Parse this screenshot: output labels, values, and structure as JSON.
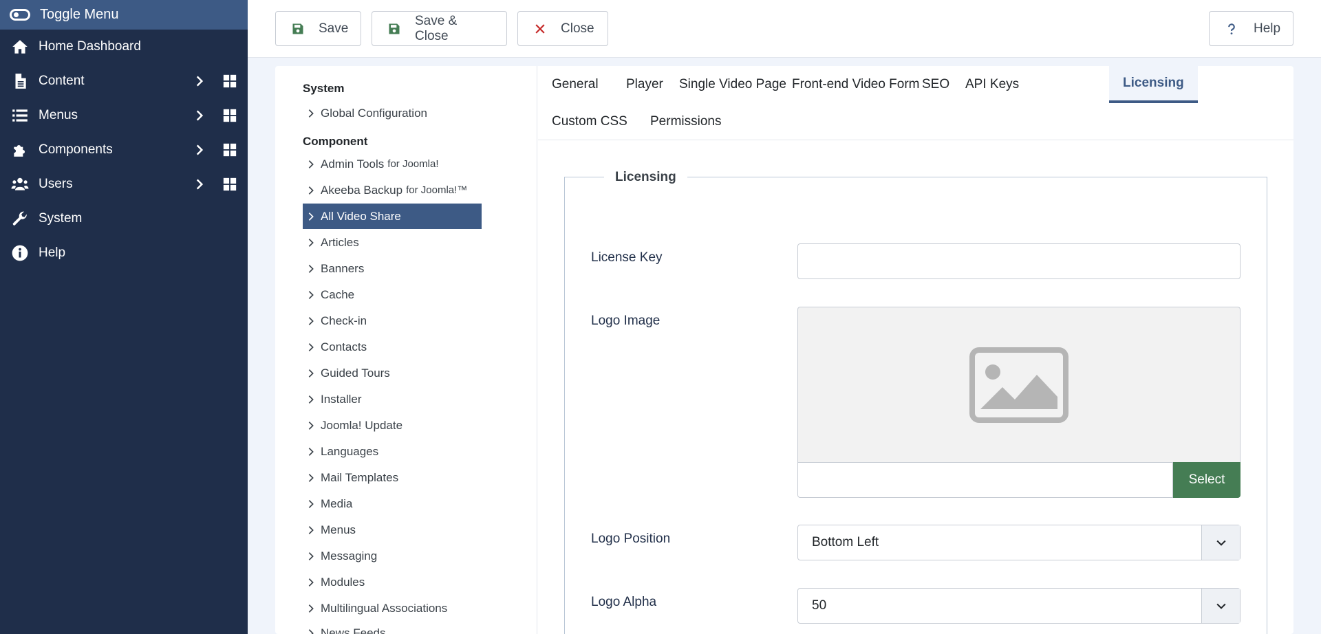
{
  "sidebar": {
    "toggle_label": "Toggle Menu",
    "items": [
      {
        "label": "Home Dashboard",
        "icon": "home-icon"
      },
      {
        "label": "Content",
        "icon": "file-icon"
      },
      {
        "label": "Menus",
        "icon": "list-icon"
      },
      {
        "label": "Components",
        "icon": "puzzle-icon"
      },
      {
        "label": "Users",
        "icon": "users-icon"
      },
      {
        "label": "System",
        "icon": "wrench-icon"
      },
      {
        "label": "Help",
        "icon": "info-icon"
      }
    ]
  },
  "toolbar": {
    "save": "Save",
    "save_close": "Save & Close",
    "close": "Close",
    "help": "Help"
  },
  "leftnav": {
    "system_heading": "System",
    "global_config": "Global Configuration",
    "component_heading": "Component",
    "items": [
      {
        "label": "Admin Tools",
        "suffix": "for Joomla!"
      },
      {
        "label": "Akeeba Backup",
        "suffix": "for Joomla!™"
      },
      {
        "label": "All Video Share"
      },
      {
        "label": "Articles"
      },
      {
        "label": "Banners"
      },
      {
        "label": "Cache"
      },
      {
        "label": "Check-in"
      },
      {
        "label": "Contacts"
      },
      {
        "label": "Guided Tours"
      },
      {
        "label": "Installer"
      },
      {
        "label": "Joomla! Update"
      },
      {
        "label": "Languages"
      },
      {
        "label": "Mail Templates"
      },
      {
        "label": "Media"
      },
      {
        "label": "Menus"
      },
      {
        "label": "Messaging"
      },
      {
        "label": "Modules"
      },
      {
        "label": "Multilingual Associations"
      },
      {
        "label": "News Feeds"
      }
    ]
  },
  "tabs": [
    "General",
    "Player",
    "Single Video Page",
    "Front-end Video Form",
    "SEO",
    "API Keys",
    "Licensing",
    "Custom CSS",
    "Permissions"
  ],
  "form": {
    "legend": "Licensing",
    "license_key_label": "License Key",
    "license_key_value": "",
    "logo_image_label": "Logo Image",
    "select_button": "Select",
    "logo_position_label": "Logo Position",
    "logo_position_value": "Bottom Left",
    "logo_alpha_label": "Logo Alpha",
    "logo_alpha_value": "50"
  },
  "colors": {
    "sidebar_bg": "#1f2e4a",
    "accent": "#3d5a85",
    "save_green": "#457d54",
    "close_red": "#c52827"
  }
}
